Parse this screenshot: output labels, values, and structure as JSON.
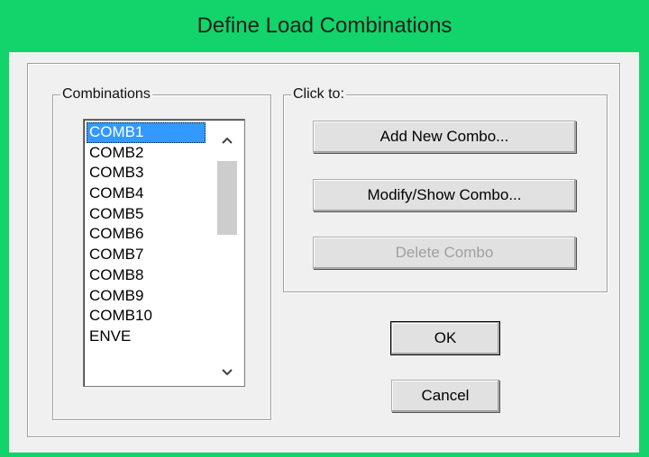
{
  "window": {
    "title": "Define Load Combinations"
  },
  "combinations_group": {
    "label": "Combinations",
    "items": [
      "COMB1",
      "COMB2",
      "COMB3",
      "COMB4",
      "COMB5",
      "COMB6",
      "COMB7",
      "COMB8",
      "COMB9",
      "COMB10",
      "ENVE"
    ],
    "selected": "COMB1"
  },
  "click_to_group": {
    "label": "Click to:",
    "add_label": "Add New Combo...",
    "modify_label": "Modify/Show Combo...",
    "delete_label": "Delete Combo"
  },
  "actions": {
    "ok_label": "OK",
    "cancel_label": "Cancel"
  },
  "icons": {
    "scroll_up": "chevron-up-icon",
    "scroll_down": "chevron-down-icon"
  },
  "colors": {
    "titlebar": "#12d46a",
    "selection": "#3399ff"
  }
}
